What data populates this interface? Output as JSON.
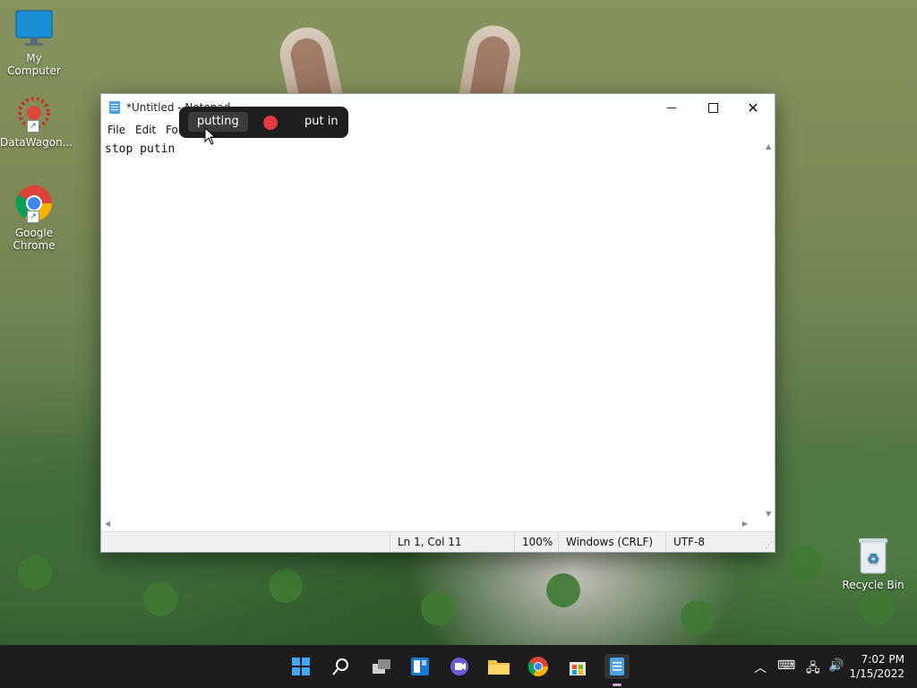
{
  "desktop": {
    "icons": [
      {
        "label": "My Computer"
      },
      {
        "label": "DataWagon..."
      },
      {
        "label": "Google Chrome"
      },
      {
        "label": "Recycle Bin"
      }
    ]
  },
  "notepad": {
    "title": "*Untitled - Notepad",
    "menu": [
      "File",
      "Edit",
      "For"
    ],
    "content": "stop putin",
    "status": {
      "position": "Ln 1, Col 11",
      "zoom": "100%",
      "line_ending": "Windows (CRLF)",
      "encoding": "UTF-8"
    }
  },
  "suggestions": {
    "items": [
      "putting",
      "put in"
    ]
  },
  "taskbar": {
    "time": "7:02 PM",
    "date": "1/15/2022"
  }
}
